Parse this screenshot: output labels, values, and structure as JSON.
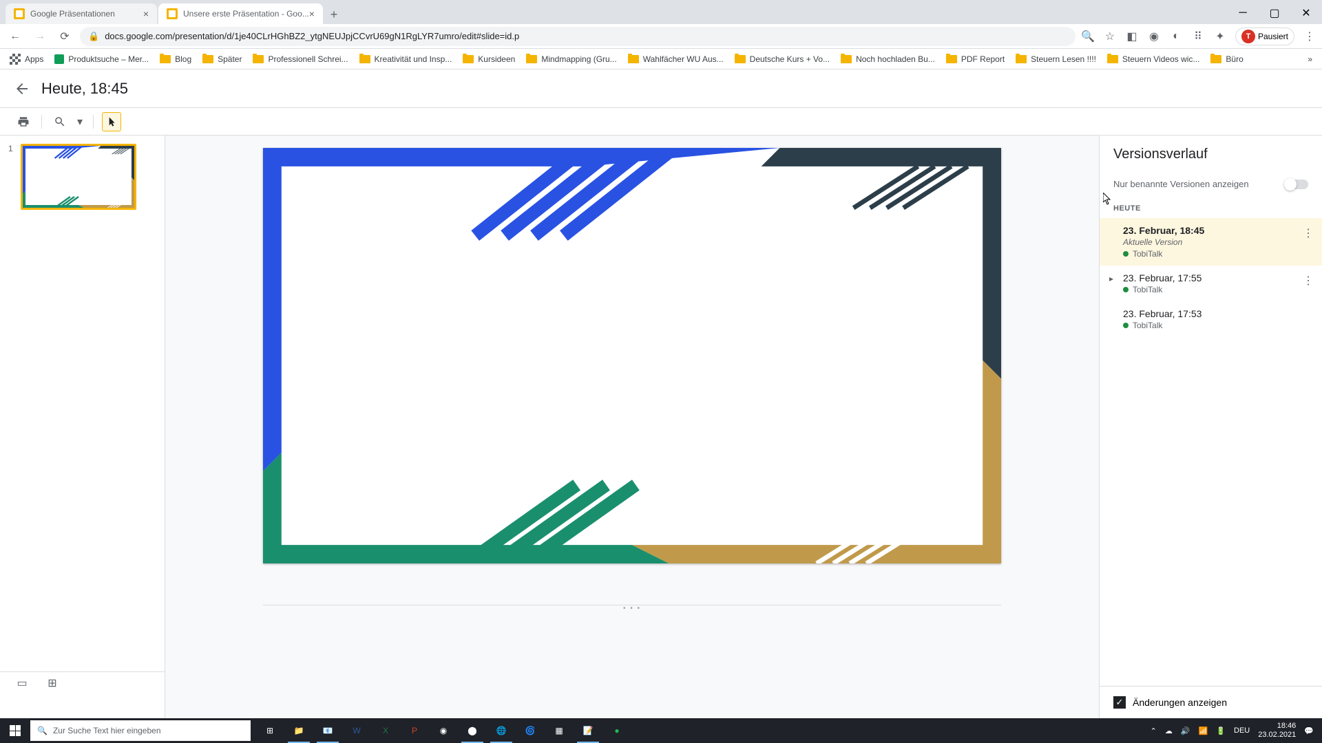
{
  "browser": {
    "tabs": [
      {
        "title": "Google Präsentationen"
      },
      {
        "title": "Unsere erste Präsentation - Goo..."
      }
    ],
    "url": "docs.google.com/presentation/d/1je40CLrHGhBZ2_ytgNEUJpjCCvrU69gN1RgLYR7umro/edit#slide=id.p",
    "profile_letter": "T",
    "profile_status": "Pausiert",
    "bookmarks": [
      {
        "label": "Apps",
        "type": "apps"
      },
      {
        "label": "Produktsuche – Mer...",
        "type": "icon"
      },
      {
        "label": "Blog",
        "type": "folder"
      },
      {
        "label": "Später",
        "type": "folder"
      },
      {
        "label": "Professionell Schrei...",
        "type": "folder"
      },
      {
        "label": "Kreativität und Insp...",
        "type": "folder"
      },
      {
        "label": "Kursideen",
        "type": "folder"
      },
      {
        "label": "Mindmapping  (Gru...",
        "type": "folder"
      },
      {
        "label": "Wahlfächer WU Aus...",
        "type": "folder"
      },
      {
        "label": "Deutsche Kurs + Vo...",
        "type": "folder"
      },
      {
        "label": "Noch hochladen Bu...",
        "type": "folder"
      },
      {
        "label": "PDF Report",
        "type": "folder"
      },
      {
        "label": "Steuern Lesen !!!!",
        "type": "folder"
      },
      {
        "label": "Steuern Videos wic...",
        "type": "folder"
      },
      {
        "label": "Büro",
        "type": "folder"
      }
    ]
  },
  "header": {
    "title": "Heute, 18:45"
  },
  "slides": {
    "thumbnail_number": "1"
  },
  "version_history": {
    "title": "Versionsverlauf",
    "toggle_label": "Nur benannte Versionen anzeigen",
    "section": "HEUTE",
    "items": [
      {
        "title": "23. Februar, 18:45",
        "subtitle": "Aktuelle Version",
        "user": "TobiTalk",
        "selected": true,
        "expandable": false
      },
      {
        "title": "23. Februar, 17:55",
        "subtitle": "",
        "user": "TobiTalk",
        "selected": false,
        "expandable": true
      },
      {
        "title": "23. Februar, 17:53",
        "subtitle": "",
        "user": "TobiTalk",
        "selected": false,
        "expandable": false
      }
    ],
    "footer_checkbox_label": "Änderungen anzeigen"
  },
  "taskbar": {
    "search_placeholder": "Zur Suche Text hier eingeben",
    "lang": "DEU",
    "time": "18:46",
    "date": "23.02.2021"
  }
}
